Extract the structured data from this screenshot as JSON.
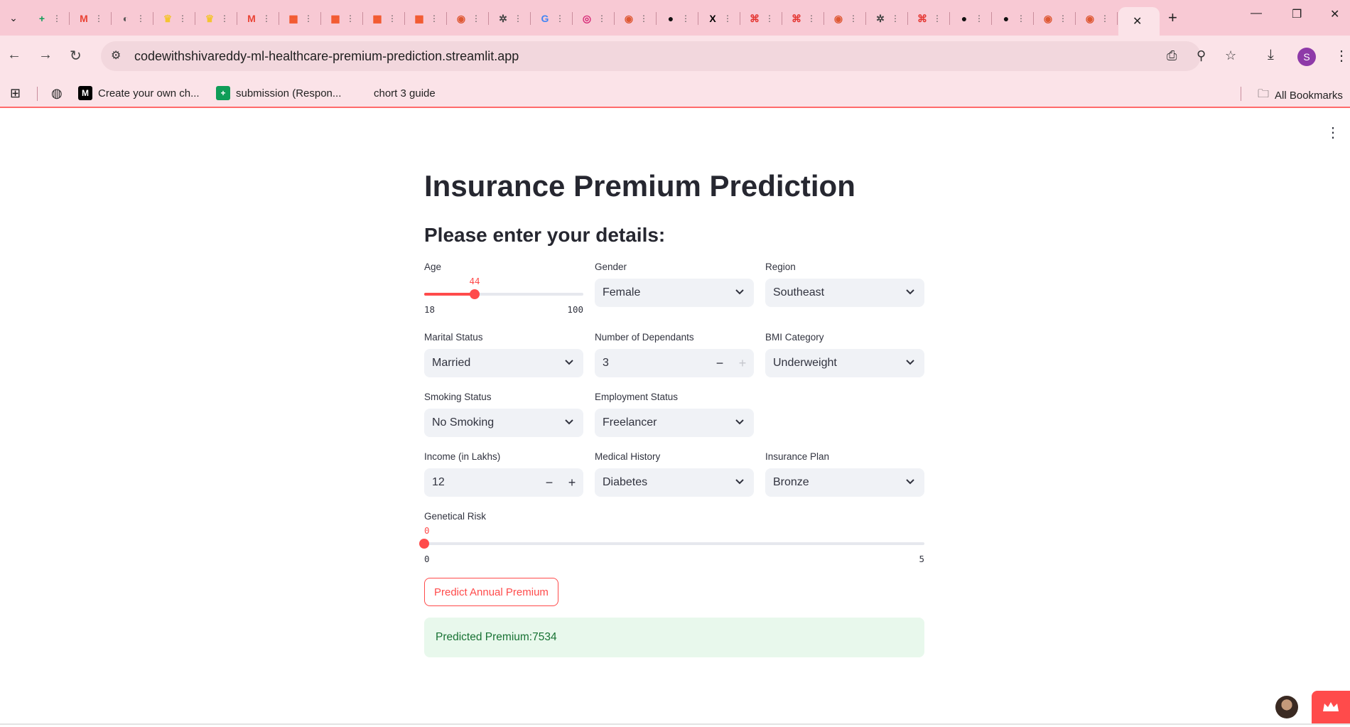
{
  "browser": {
    "tabs": [
      {
        "icon": "sheets-icon",
        "color": "#0f9d58",
        "glyph": "+"
      },
      {
        "icon": "gmail-icon",
        "color": "#ea4335",
        "glyph": "M"
      },
      {
        "icon": "globe-icon",
        "color": "#555555",
        "glyph": "◐"
      },
      {
        "icon": "chess-icon",
        "color": "#f4c430",
        "glyph": "♛"
      },
      {
        "icon": "chess-icon",
        "color": "#f4c430",
        "glyph": "♛"
      },
      {
        "icon": "gmail-icon",
        "color": "#ea4335",
        "glyph": "M"
      },
      {
        "icon": "microsoft-icon",
        "color": "#f25022",
        "glyph": "▦"
      },
      {
        "icon": "microsoft-icon",
        "color": "#f25022",
        "glyph": "▦"
      },
      {
        "icon": "microsoft-icon",
        "color": "#f25022",
        "glyph": "▦"
      },
      {
        "icon": "microsoft-icon",
        "color": "#f25022",
        "glyph": "▦"
      },
      {
        "icon": "duckduckgo-icon",
        "color": "#de5833",
        "glyph": "◉"
      },
      {
        "icon": "openai-icon",
        "color": "#444444",
        "glyph": "✲"
      },
      {
        "icon": "google-icon",
        "color": "#4285f4",
        "glyph": "G"
      },
      {
        "icon": "instagram-icon",
        "color": "#d62976",
        "glyph": "◎"
      },
      {
        "icon": "duckduckgo-icon",
        "color": "#de5833",
        "glyph": "◉"
      },
      {
        "icon": "github-icon",
        "color": "#111111",
        "glyph": "●"
      },
      {
        "icon": "x-icon",
        "color": "#000000",
        "glyph": "X"
      },
      {
        "icon": "codeforces-icon",
        "color": "#e53935",
        "glyph": "⌘"
      },
      {
        "icon": "codeforces-icon",
        "color": "#e53935",
        "glyph": "⌘"
      },
      {
        "icon": "duckduckgo-icon",
        "color": "#de5833",
        "glyph": "◉"
      },
      {
        "icon": "openai-icon",
        "color": "#444444",
        "glyph": "✲"
      },
      {
        "icon": "codeforces-icon",
        "color": "#e53935",
        "glyph": "⌘"
      },
      {
        "icon": "github-icon",
        "color": "#111111",
        "glyph": "●"
      },
      {
        "icon": "github-icon",
        "color": "#111111",
        "glyph": "●"
      },
      {
        "icon": "duckduckgo-icon",
        "color": "#de5833",
        "glyph": "◉"
      },
      {
        "icon": "duckduckgo-icon",
        "color": "#de5833",
        "glyph": "◉"
      }
    ],
    "url": "codewithshivareddy-ml-healthcare-premium-prediction.streamlit.app",
    "profile_initial": "S",
    "bookmarks": {
      "item1": "Create your own ch...",
      "item2": "submission (Respon...",
      "item3": "chort 3 guide",
      "all": "All Bookmarks"
    }
  },
  "app": {
    "title": "Insurance Premium Prediction",
    "subtitle": "Please enter your details:",
    "age": {
      "label": "Age",
      "value": "44",
      "min": "18",
      "max": "100",
      "fraction": 0.317
    },
    "gender": {
      "label": "Gender",
      "value": "Female"
    },
    "region": {
      "label": "Region",
      "value": "Southeast"
    },
    "marital": {
      "label": "Marital Status",
      "value": "Married"
    },
    "dependants": {
      "label": "Number of Dependants",
      "value": "3"
    },
    "bmi": {
      "label": "BMI Category",
      "value": "Underweight"
    },
    "smoking": {
      "label": "Smoking Status",
      "value": "No Smoking"
    },
    "employment": {
      "label": "Employment Status",
      "value": "Freelancer"
    },
    "income": {
      "label": "Income (in Lakhs)",
      "value": "12"
    },
    "medical": {
      "label": "Medical History",
      "value": "Diabetes"
    },
    "plan": {
      "label": "Insurance Plan",
      "value": "Bronze"
    },
    "genetic": {
      "label": "Genetical Risk",
      "value": "0",
      "min": "0",
      "max": "5",
      "fraction": 0
    },
    "predict_button": "Predict Annual Premium",
    "result": "Predicted Premium:7534",
    "accent": "#ff4b4b",
    "success_bg": "#e8f8ec",
    "success_text": "#177233"
  }
}
